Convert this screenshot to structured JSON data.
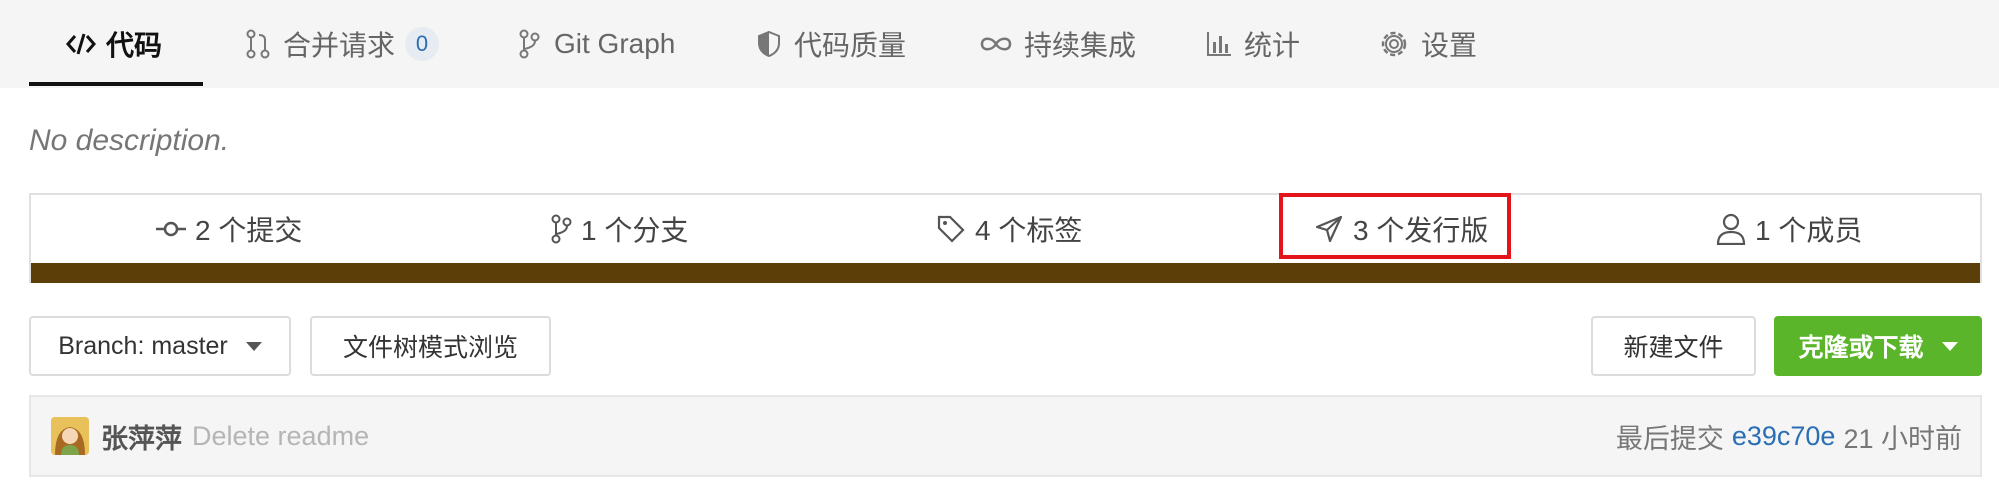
{
  "tabs": [
    {
      "label": "代码",
      "icon": "code-icon",
      "active": true
    },
    {
      "label": "合并请求",
      "icon": "pull-request-icon",
      "badge": "0"
    },
    {
      "label": "Git Graph",
      "icon": "git-branch-icon"
    },
    {
      "label": "代码质量",
      "icon": "shield-icon"
    },
    {
      "label": "持续集成",
      "icon": "infinity-icon"
    },
    {
      "label": "统计",
      "icon": "bar-chart-icon"
    },
    {
      "label": "设置",
      "icon": "gear-icon"
    }
  ],
  "description": "No description.",
  "stats": [
    {
      "label": "2 个提交",
      "icon": "commit-icon"
    },
    {
      "label": "1 个分支",
      "icon": "branch-icon"
    },
    {
      "label": "4 个标签",
      "icon": "tag-icon"
    },
    {
      "label": "3 个发行版",
      "icon": "send-icon"
    },
    {
      "label": "1 个成员",
      "icon": "user-icon"
    }
  ],
  "colors": {
    "language_bar": "#5c3e08",
    "highlight": "#e4141b",
    "primary": "#5ab52a",
    "link": "#2a6fb5"
  },
  "controls": {
    "branch_label": "Branch: master",
    "tree_view_label": "文件树模式浏览",
    "new_file_label": "新建文件",
    "clone_label": "克隆或下载"
  },
  "commit": {
    "author": "张萍萍",
    "message": "Delete readme",
    "last_commit_label": "最后提交",
    "sha": "e39c70e",
    "time": "21 小时前"
  }
}
